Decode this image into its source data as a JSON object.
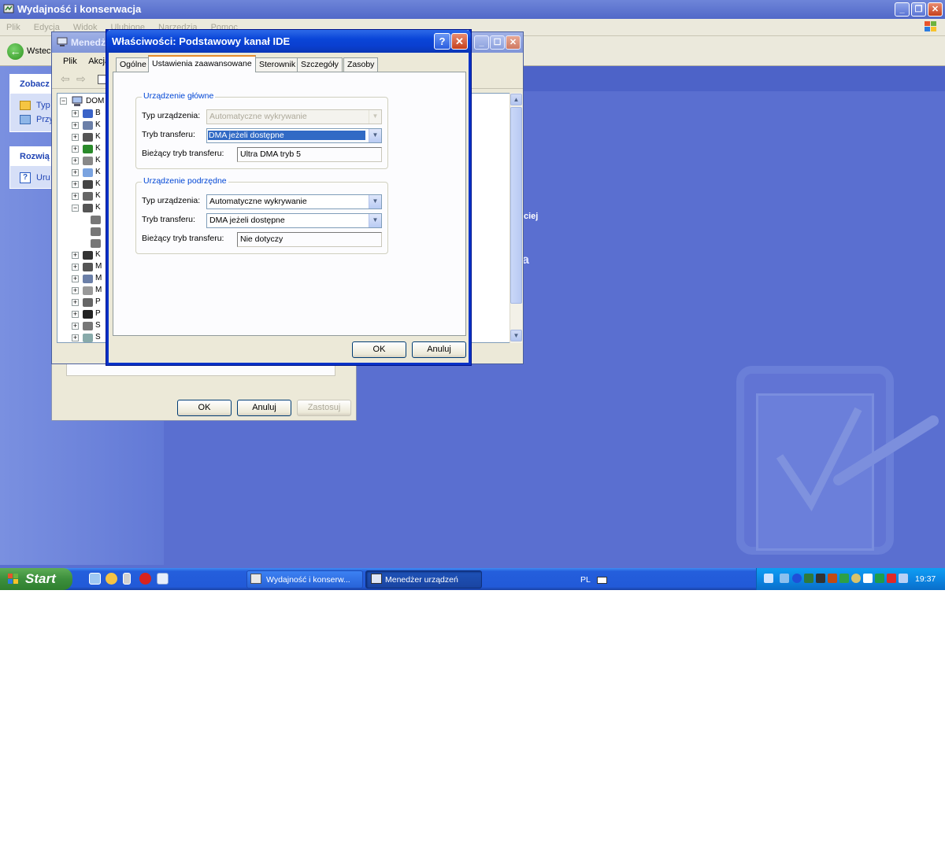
{
  "explorer": {
    "title": "Wydajność i konserwacja",
    "menu": [
      "Plik",
      "Edycja",
      "Widok",
      "Ulubione",
      "Narzędzia",
      "Pomoc"
    ],
    "back_label": "Wstecz",
    "see_also_head": "Zobacz",
    "see_also_items": [
      "Typ",
      "Przy"
    ],
    "troubleshoot_head": "Rozwią",
    "troubleshoot_items": [
      "Uru"
    ],
    "fragment_1": "ciej",
    "fragment_2": "a"
  },
  "device_manager": {
    "title": "Menedżer urządzeń",
    "menu": [
      "Plik",
      "Akcja"
    ],
    "tree_root": "DOM",
    "tree_letters": [
      "B",
      "K",
      "K",
      "K",
      "K",
      "K",
      "K",
      "K",
      "K",
      "",
      "",
      "",
      "K",
      "M",
      "M",
      "M",
      "P",
      "P",
      "S",
      "S"
    ]
  },
  "bg_dialog": {
    "ok": "OK",
    "cancel": "Anuluj",
    "apply": "Zastosuj"
  },
  "properties": {
    "title": "Właściwości: Podstawowy kanał IDE",
    "tabs": [
      "Ogólne",
      "Ustawienia zaawansowane",
      "Sterownik",
      "Szczegóły",
      "Zasoby"
    ],
    "active_tab": "Ustawienia zaawansowane",
    "master": {
      "group": "Urządzenie główne",
      "type_label": "Typ urządzenia:",
      "type_value": "Automatyczne wykrywanie",
      "transfer_label": "Tryb transferu:",
      "transfer_value": "DMA jeżeli dostępne",
      "current_label": "Bieżący tryb transferu:",
      "current_value": "Ultra DMA tryb 5"
    },
    "slave": {
      "group": "Urządzenie podrzędne",
      "type_label": "Typ urządzenia:",
      "type_value": "Automatyczne wykrywanie",
      "transfer_label": "Tryb transferu:",
      "transfer_value": "DMA jeżeli dostępne",
      "current_label": "Bieżący tryb transferu:",
      "current_value": "Nie dotyczy"
    },
    "ok": "OK",
    "cancel": "Anuluj"
  },
  "taskbar": {
    "start": "Start",
    "tasks": [
      "Wydajność i konserw...",
      "Menedżer urządzeń"
    ],
    "language": "PL",
    "clock": "19:37"
  },
  "colors": {
    "xp_blue": "#0a45d8",
    "desktop": "#5a6fd0",
    "dialog_bg": "#ece9d8",
    "group_title": "#0046d5",
    "selection": "#316ac5"
  }
}
